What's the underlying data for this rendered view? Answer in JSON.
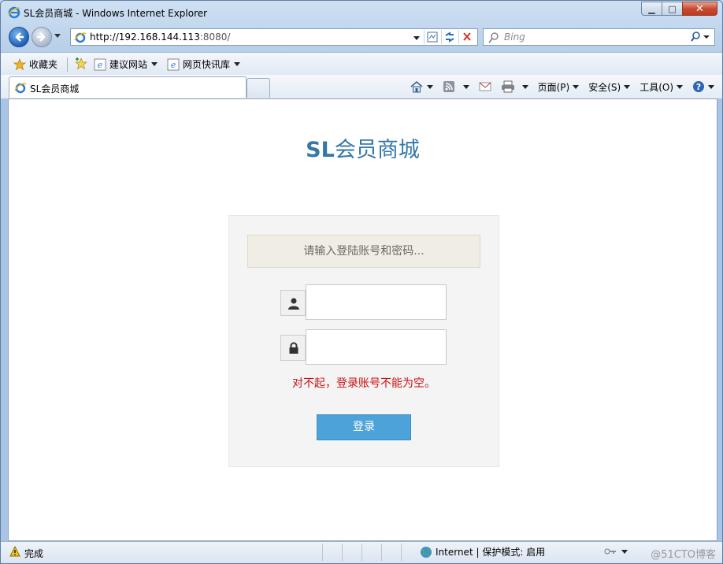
{
  "window": {
    "title": "SL会员商城 - Windows Internet Explorer"
  },
  "nav": {
    "address_host": "http://192.168.144.113",
    "address_port": ":8080/",
    "search_placeholder": "Bing"
  },
  "favorites": {
    "favorites_label": "收藏夹",
    "suggested_sites_label": "建议网站",
    "web_slice_label": "网页快讯库"
  },
  "tabs": [
    {
      "label": "SL会员商城"
    }
  ],
  "commands": {
    "page_label": "页面(P)",
    "safety_label": "安全(S)",
    "tools_label": "工具(O)"
  },
  "page": {
    "title_prefix": "SL",
    "title_suffix": "会员商城",
    "hint": "请输入登陆账号和密码...",
    "username_value": "",
    "password_value": "",
    "error_message": "对不起，登录账号不能为空。",
    "login_button_label": "登录"
  },
  "status": {
    "text": "完成",
    "zone_label": "Internet | 保护模式: 启用",
    "watermark": "@51CTO博客"
  },
  "colors": {
    "title": "#3478a8",
    "login_button": "#4da3d9",
    "error": "#cc1111",
    "hint_bg": "#efede4"
  }
}
